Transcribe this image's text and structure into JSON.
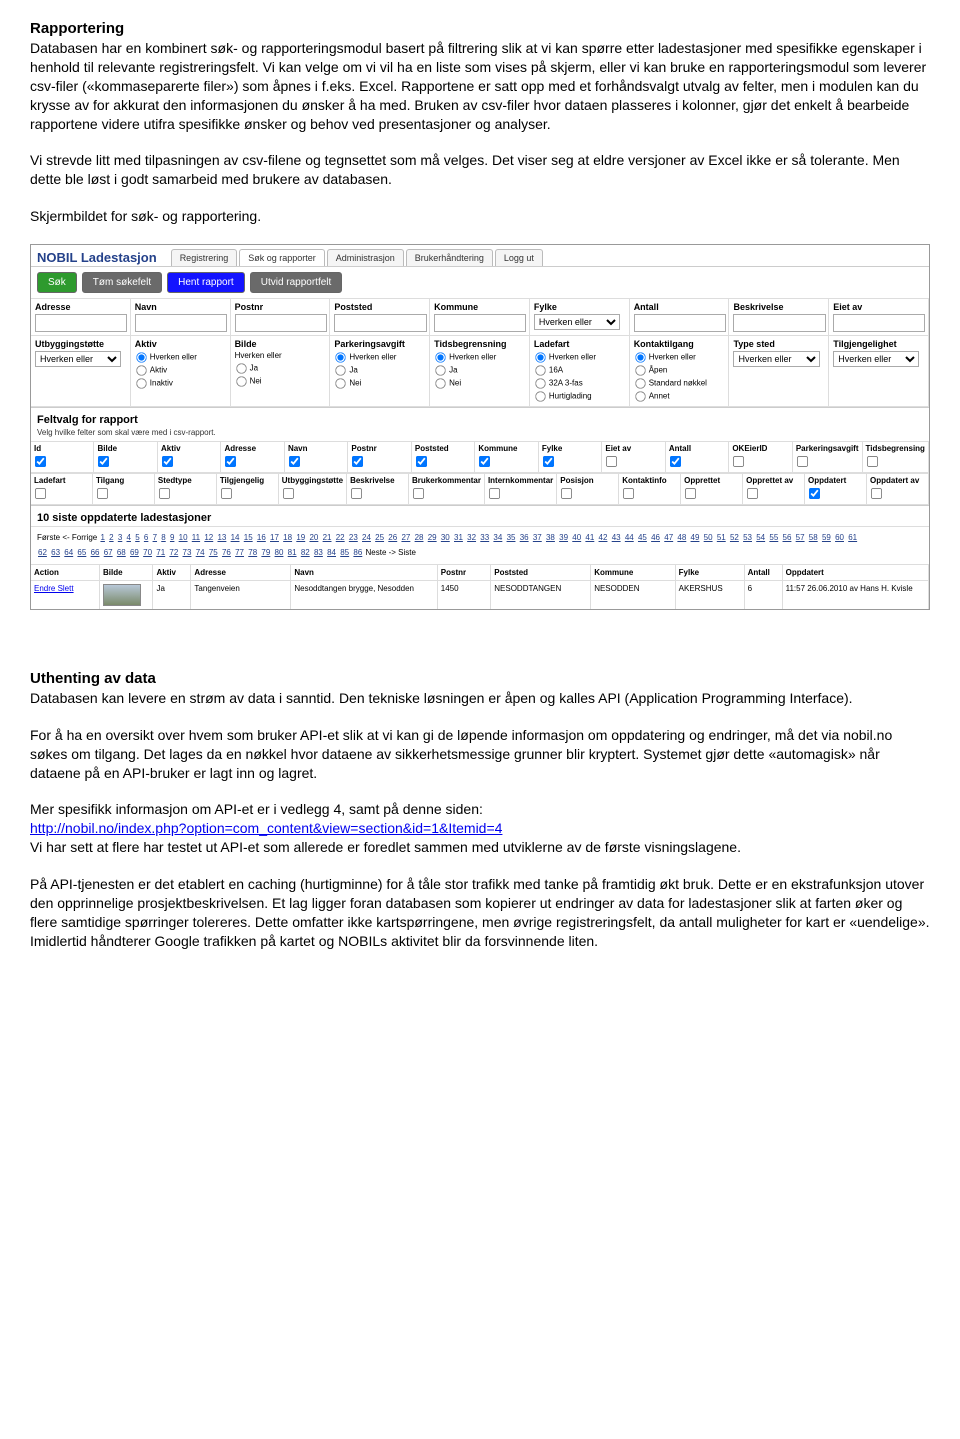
{
  "h1": "Rapportering",
  "p1": "Databasen har en kombinert søk- og rapporteringsmodul basert på filtrering slik at vi kan spørre etter ladestasjoner med spesifikke egenskaper i henhold til relevante registreringsfelt. Vi kan velge om vi vil ha en liste som vises på skjerm, eller vi kan bruke en rapporteringsmodul som leverer csv-filer («kommaseparerte filer») som åpnes i f.eks. Excel. Rapportene er satt opp med et forhåndsvalgt utvalg av felter, men i modulen kan du krysse av for akkurat den informasjonen du ønsker å ha med. Bruken av csv-filer hvor dataen plasseres i kolonner, gjør det enkelt å bearbeide rapportene videre utifra spesifikke ønsker og behov ved presentasjoner og analyser.",
  "p2": "Vi strevde litt med tilpasningen av csv-filene og tegnsettet som må velges. Det viser seg at eldre versjoner av Excel ikke er så tolerante. Men dette ble løst i godt samarbeid med brukere av databasen.",
  "p3": "Skjermbildet for søk- og rapportering.",
  "screenshot": {
    "brand": "NOBIL Ladestasjon",
    "tabs": [
      "Registrering",
      "Søk og rapporter",
      "Administrasjon",
      "Brukerhåndtering",
      "Logg ut"
    ],
    "btns": {
      "sok": "Søk",
      "tom": "Tøm søkefelt",
      "hent": "Hent rapport",
      "utvid": "Utvid rapportfelt"
    },
    "filters1": [
      "Adresse",
      "Navn",
      "Postnr",
      "Poststed",
      "Kommune",
      "Fylke",
      "Antall",
      "Beskrivelse",
      "Eiet av"
    ],
    "neither": "Hverken eller",
    "filters2": {
      "heads": [
        "Utbyggingstøtte",
        "Aktiv",
        "Bilde",
        "Parkeringsavgift",
        "Tidsbegrensning",
        "Ladefart",
        "Kontaktilgang",
        "Type sted",
        "Tilgjengelighet"
      ],
      "aktiv": [
        "Hverken eller",
        "Aktiv",
        "Inaktiv"
      ],
      "bilde": [
        "Hverken eller",
        "Ja",
        "Nei"
      ],
      "parkering": [
        "Hverken eller",
        "Ja",
        "Nei"
      ],
      "tid": [
        "Hverken eller",
        "Ja",
        "Nei"
      ],
      "ladefart": [
        "Hverken eller",
        "16A",
        "32A 3-fas",
        "Hurtiglading"
      ],
      "kontakt": [
        "Hverken eller",
        "Åpen",
        "Standard nøkkel",
        "Annet"
      ]
    },
    "feltvalg_head": "Feltvalg for rapport",
    "feltvalg_sub": "Velg hvilke felter som skal være med i csv-rapport.",
    "checkrow1": [
      "Id",
      "Bilde",
      "Aktiv",
      "Adresse",
      "Navn",
      "Postnr",
      "Poststed",
      "Kommune",
      "Fylke",
      "Eiet av",
      "Antall",
      "OKEierID",
      "Parkeringsavgift",
      "Tidsbegrensing"
    ],
    "checkrow1_checked": [
      true,
      true,
      true,
      true,
      true,
      true,
      true,
      true,
      true,
      false,
      true,
      false,
      false,
      false
    ],
    "checkrow2": [
      "Ladefart",
      "Tilgang",
      "Stedtype",
      "Tilgjengelig",
      "Utbyggingstøtte",
      "Beskrivelse",
      "Brukerkommentar",
      "Internkommentar",
      "Posisjon",
      "Kontaktinfo",
      "Opprettet",
      "Opprettet av",
      "Oppdatert",
      "Oppdatert av"
    ],
    "checkrow2_checked": [
      false,
      false,
      false,
      false,
      false,
      false,
      false,
      false,
      false,
      false,
      false,
      false,
      true,
      false
    ],
    "siste_head": "10 siste oppdaterte ladestasjoner",
    "pager_prefix": "Første <- Forrige",
    "pager_suffix": "Neste -> Siste",
    "datahead": [
      "Action",
      "Bilde",
      "Aktiv",
      "Adresse",
      "Navn",
      "Postnr",
      "Poststed",
      "Kommune",
      "Fylke",
      "Antall",
      "Oppdatert"
    ],
    "datarow": {
      "action": "Endre Slett",
      "aktiv": "Ja",
      "adresse": "Tangenveien",
      "navn": "Nesoddtangen brygge, Nesodden",
      "postnr": "1450",
      "poststed": "NESODDTANGEN",
      "kommune": "NESODDEN",
      "fylke": "AKERSHUS",
      "antall": "6",
      "oppdatert": "11:57 26.06.2010 av Hans H. Kvisle"
    }
  },
  "h2": "Uthenting av data",
  "p4": "Databasen kan levere en strøm av data i sanntid. Den tekniske løsningen er åpen og kalles API (Application Programming Interface).",
  "p5": "For å ha en oversikt over hvem som bruker API-et slik at vi kan gi de løpende informasjon om oppdatering og endringer, må det via nobil.no søkes om tilgang. Det lages da en nøkkel hvor dataene av sikkerhetsmessige grunner blir kryptert. Systemet gjør dette «automagisk» når dataene på en API-bruker er lagt inn og lagret.",
  "p6a": "Mer spesifikk informasjon om API-et er i vedlegg 4, samt på denne siden:",
  "link": "http://nobil.no/index.php?option=com_content&view=section&id=1&Itemid=4",
  "p6b": "Vi har sett at flere har testet ut API-et som allerede er foredlet sammen med utviklerne av de første visningslagene.",
  "p7": "På API-tjenesten er det etablert en caching (hurtigminne) for å tåle stor trafikk med tanke på framtidig økt bruk. Dette er en ekstrafunksjon utover den opprinnelige prosjektbeskrivelsen. Et lag ligger foran databasen som kopierer ut endringer av data for ladestasjoner slik at farten øker og flere samtidige spørringer tolereres. Dette omfatter ikke kartspørringene, men øvrige registreringsfelt, da antall muligheter for kart er «uendelige». Imidlertid håndterer Google trafikken på kartet og NOBILs aktivitet blir da forsvinnende liten."
}
